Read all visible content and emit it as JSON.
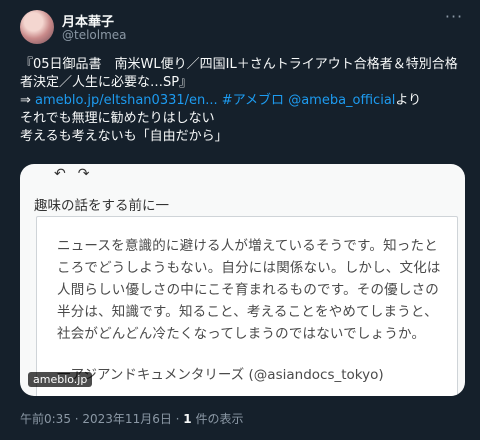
{
  "header": {
    "name": "月本華子",
    "handle": "@telolmea"
  },
  "tweet": {
    "line1": "『05日御品書　南米WL便り／四国IL＋さんトライアウト合格者＆特別合格",
    "line2": "者決定／人生に必要な…SP』",
    "arrow": "⇒ ",
    "link_url": "ameblo.jp/eltshan0331/en...",
    "hashtag": "#アメブロ",
    "mention": "@ameba_official",
    "yori": "より",
    "line4": "それでも無理に勧めたりはしない",
    "line5": "考えるも考えないも「自由だから」"
  },
  "card": {
    "title": "趣味の話をする前に一",
    "quote": "ニュースを意識的に避ける人が増えているそうです。知ったところでどうしようもない。自分には関係ない。しかし、文化は人間らしい優しさの中にこそ育まれるものです。その優しさの半分は、知識です。知ること、考えることをやめてしまうと、社会がどんどん冷たくなってしまうのではないでしょうか。",
    "credit": "一アジアンドキュメンタリーズ (@asiandocs_tokyo)",
    "domain": "ameblo.jp"
  },
  "footer": {
    "time": "午前0:35 · 2023年11月6日 · ",
    "views_count": "1",
    "views_label": " 件の表示"
  }
}
